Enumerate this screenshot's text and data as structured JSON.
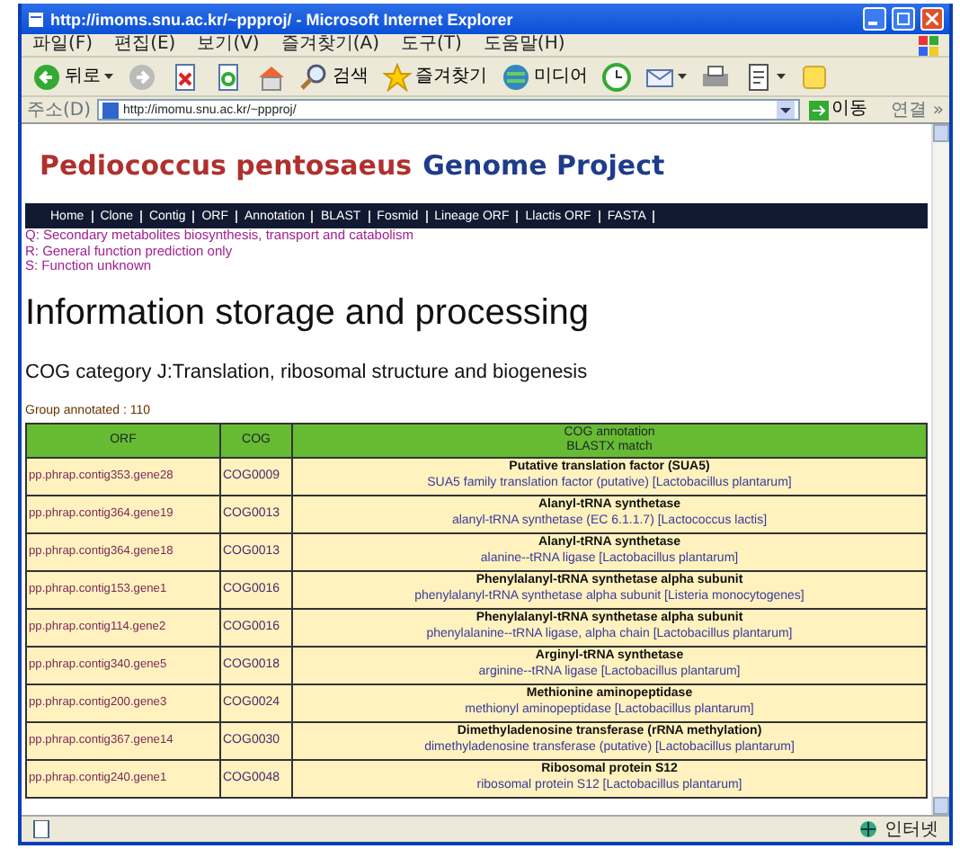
{
  "window": {
    "title": "http://imoms.snu.ac.kr/~ppproj/ - Microsoft Internet Explorer",
    "menu": [
      "파일(F)",
      "편집(E)",
      "보기(V)",
      "즐겨찾기(A)",
      "도구(T)",
      "도움말(H)"
    ],
    "toolbar": [
      {
        "kind": "back",
        "label": "뒤로",
        "dropdown": true
      },
      {
        "kind": "forward",
        "dropdown": false
      },
      {
        "kind": "stop",
        "dropdown": false
      },
      {
        "kind": "refresh",
        "dropdown": false
      },
      {
        "kind": "home",
        "dropdown": false
      },
      {
        "kind": "search",
        "label": "검색",
        "dropdown": false
      },
      {
        "kind": "favorites",
        "label": "즐겨찾기",
        "dropdown": false
      },
      {
        "kind": "media",
        "label": "미디어",
        "dropdown": false
      },
      {
        "kind": "history",
        "dropdown": false
      },
      {
        "kind": "mail",
        "dropdown": true
      },
      {
        "kind": "print",
        "dropdown": false
      },
      {
        "kind": "edit",
        "dropdown": true
      },
      {
        "kind": "messenger",
        "dropdown": false
      }
    ],
    "address": {
      "label": "주소(D)",
      "value": "http://imomu.snu.ac.kr/~ppproj/",
      "go": "이동",
      "links": "연결 »"
    }
  },
  "page": {
    "logo": {
      "species": "Pediococcus pentosaeus",
      "project": "Genome Project"
    },
    "nav": [
      "Home",
      "Clone",
      "Contig",
      "ORF",
      "Annotation",
      "BLAST",
      "Fosmid",
      "Lineage ORF",
      "Llactis ORF",
      "FASTA"
    ],
    "category_list": [
      "Q: Secondary metabolites biosynthesis, transport and catabolism",
      "R: General function prediction only",
      "S: Function unknown"
    ],
    "heading": "Information storage and processing",
    "subheading": "COG category J:Translation, ribosomal structure and biogenesis",
    "group_count": "Group annotated : 110",
    "table": {
      "columns": [
        {
          "label": "ORF"
        },
        {
          "label": "COG"
        },
        {
          "label": "COG annotation",
          "sublabel": "BLASTX match"
        }
      ],
      "rows": [
        {
          "orf": "pp.phrap.contig353.gene28",
          "cog": "COG0009",
          "annotation": "Putative translation factor (SUA5)",
          "match": "SUA5 family translation factor (putative) [Lactobacillus plantarum]"
        },
        {
          "orf": "pp.phrap.contig364.gene19",
          "cog": "COG0013",
          "annotation": "Alanyl-tRNA synthetase",
          "match": "alanyl-tRNA synthetase (EC 6.1.1.7) [Lactococcus lactis]"
        },
        {
          "orf": "pp.phrap.contig364.gene18",
          "cog": "COG0013",
          "annotation": "Alanyl-tRNA synthetase",
          "match": "alanine--tRNA ligase [Lactobacillus plantarum]"
        },
        {
          "orf": "pp.phrap.contig153.gene1",
          "cog": "COG0016",
          "annotation": "Phenylalanyl-tRNA synthetase alpha subunit",
          "match": "phenylalanyl-tRNA synthetase alpha subunit [Listeria monocytogenes]"
        },
        {
          "orf": "pp.phrap.contig114.gene2",
          "cog": "COG0016",
          "annotation": "Phenylalanyl-tRNA synthetase alpha subunit",
          "match": "phenylalanine--tRNA ligase, alpha chain [Lactobacillus plantarum]"
        },
        {
          "orf": "pp.phrap.contig340.gene5",
          "cog": "COG0018",
          "annotation": "Arginyl-tRNA synthetase",
          "match": "arginine--tRNA ligase [Lactobacillus plantarum]"
        },
        {
          "orf": "pp.phrap.contig200.gene3",
          "cog": "COG0024",
          "annotation": "Methionine aminopeptidase",
          "match": "methionyl aminopeptidase [Lactobacillus plantarum]"
        },
        {
          "orf": "pp.phrap.contig367.gene14",
          "cog": "COG0030",
          "annotation": "Dimethyladenosine transferase (rRNA methylation)",
          "match": "dimethyladenosine transferase (putative) [Lactobacillus plantarum]"
        },
        {
          "orf": "pp.phrap.contig240.gene1",
          "cog": "COG0048",
          "annotation": "Ribosomal protein S12",
          "match": "ribosomal protein S12 [Lactobacillus plantarum]"
        }
      ]
    }
  },
  "status_bar": {
    "zone": "인터넷"
  }
}
